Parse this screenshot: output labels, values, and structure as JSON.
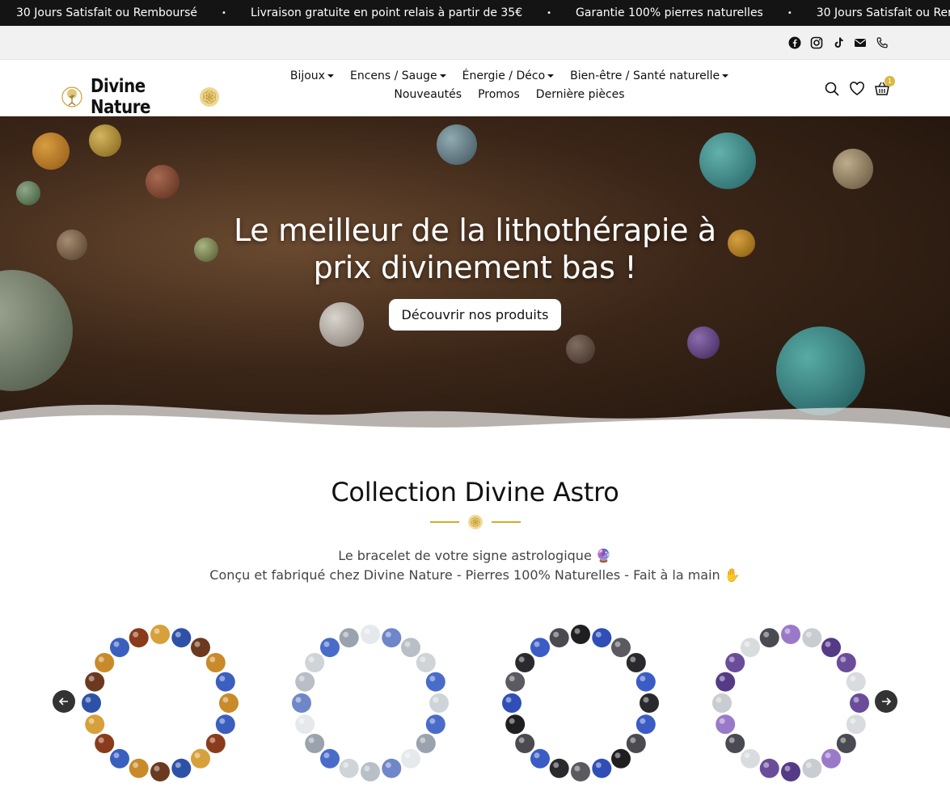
{
  "ticker": {
    "messages": [
      "30 Jours Satisfait ou Remboursé",
      "Livraison gratuite en point relais à partir de 35€",
      "Garantie 100% pierres naturelles",
      "30 Jours Satisfait ou Remboursé"
    ],
    "separator": "•"
  },
  "social": {
    "icons": [
      "facebook-icon",
      "instagram-icon",
      "tiktok-icon",
      "mail-icon",
      "phone-icon"
    ]
  },
  "header": {
    "brand": "Divine Nature",
    "nav_row1": [
      {
        "label": "Bijoux",
        "dropdown": true
      },
      {
        "label": "Encens / Sauge",
        "dropdown": true
      },
      {
        "label": "Énergie / Déco",
        "dropdown": true
      },
      {
        "label": "Bien-être / Santé naturelle",
        "dropdown": true
      }
    ],
    "nav_row2": [
      {
        "label": "Nouveautés"
      },
      {
        "label": "Promos"
      },
      {
        "label": "Dernière pièces"
      }
    ],
    "cart_count": "1"
  },
  "hero": {
    "title_line1": "Le meilleur de la lithothérapie à",
    "title_line2": "prix divinement bas !",
    "cta": "Découvrir nos produits"
  },
  "collection": {
    "title": "Collection Divine Astro",
    "sub_line1": "Le bracelet de votre signe astrologique 🔮",
    "sub_line2": "Conçu et fabriqué chez Divine Nature - Pierres 100% Naturelles - Fait à la main ✋"
  },
  "colors": {
    "accent": "#d4ac2b",
    "ticker_bg": "#141414",
    "arrow_bg": "#333333"
  }
}
